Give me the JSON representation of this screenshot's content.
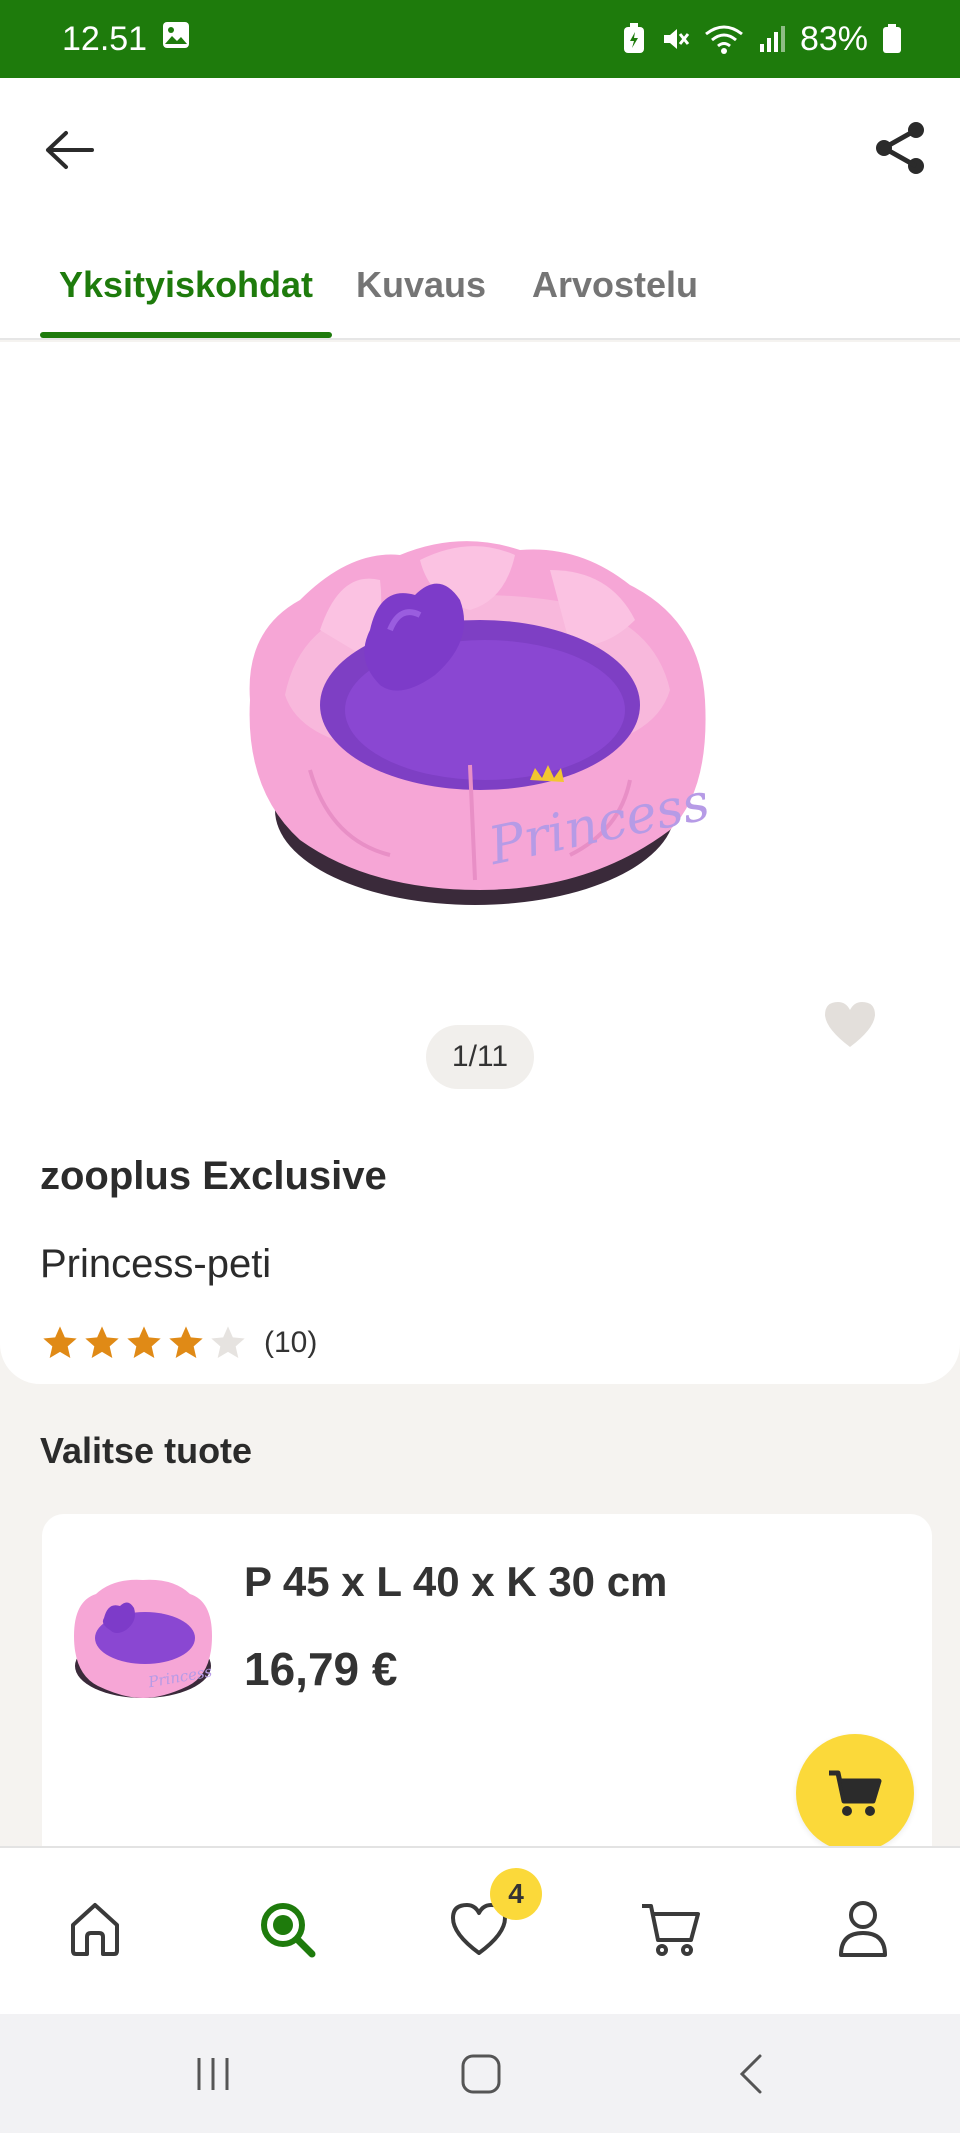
{
  "status_bar": {
    "time": "12.51",
    "battery": "83%"
  },
  "header": {
    "back_icon": "arrow-left-icon",
    "share_icon": "share-icon"
  },
  "tabs": [
    {
      "label": "Yksityiskohdat",
      "active": true
    },
    {
      "label": "Kuvaus",
      "active": false
    },
    {
      "label": "Arvostelu",
      "active": false
    }
  ],
  "product": {
    "image_counter": "1/11",
    "brand": "zooplus Exclusive",
    "name": "Princess-peti",
    "rating": 4,
    "rating_max": 5,
    "review_count": "(10)",
    "image_text": "Princess"
  },
  "variant_section": {
    "title": "Valitse tuote",
    "variants": [
      {
        "size": "P 45 x L 40 x K 30 cm",
        "price": "16,79 €"
      }
    ]
  },
  "bottom_nav": {
    "items": [
      "home-icon",
      "search-icon",
      "heart-icon",
      "cart-icon",
      "user-icon"
    ],
    "active": "search-icon",
    "favorites_badge": "4"
  },
  "colors": {
    "brand_green": "#1e7b0c",
    "accent_yellow": "#fbd93a",
    "star_orange": "#e08a16"
  }
}
